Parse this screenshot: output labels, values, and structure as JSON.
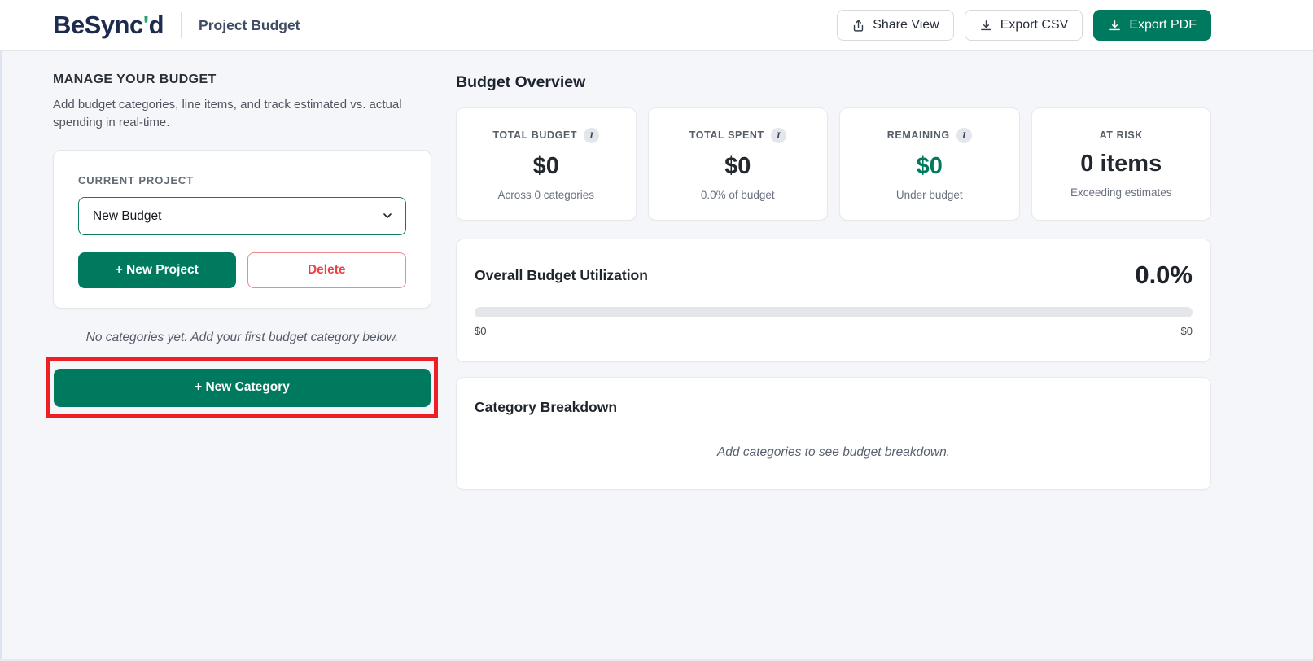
{
  "colors": {
    "brand_green": "#007a5e",
    "brand_navy": "#1d2b4e",
    "delete_red": "#ef4043",
    "annotation_red": "#ee1e24",
    "page_background": "#f5f6f9"
  },
  "header": {
    "logo_prefix": "BeSync",
    "logo_apostrophe": "'",
    "logo_suffix": "d",
    "page_title": "Project Budget",
    "share_button": "Share View",
    "export_csv_button": "Export CSV",
    "export_pdf_button": "Export PDF"
  },
  "sidebar": {
    "heading": "MANAGE YOUR BUDGET",
    "description": "Add budget categories, line items, and track estimated vs. actual spending in real-time.",
    "project_card": {
      "label": "CURRENT PROJECT",
      "selected_project": "New Budget",
      "new_project_button": "+ New Project",
      "delete_button": "Delete"
    },
    "empty_note": "No categories yet. Add your first budget category below.",
    "new_category_button": "+ New Category"
  },
  "overview": {
    "heading": "Budget Overview",
    "info_glyph": "I",
    "stats": [
      {
        "label": "TOTAL BUDGET",
        "value": "$0",
        "sub": "Across 0 categories"
      },
      {
        "label": "TOTAL SPENT",
        "value": "$0",
        "sub": "0.0% of budget"
      },
      {
        "label": "REMAINING",
        "value": "$0",
        "sub": "Under budget"
      },
      {
        "label": "AT RISK",
        "value": "0 items",
        "sub": "Exceeding estimates"
      }
    ],
    "utilization": {
      "title": "Overall Budget Utilization",
      "percent": "0.0%",
      "progress_value": 0,
      "progress_css": "width:0%",
      "min_label": "$0",
      "max_label": "$0"
    },
    "breakdown": {
      "title": "Category Breakdown",
      "empty_message": "Add categories to see budget breakdown."
    }
  },
  "icons": {
    "share": "share-up-icon",
    "download": "download-icon",
    "chevron": "chevron-down-icon",
    "info": "info-badge-icon"
  }
}
